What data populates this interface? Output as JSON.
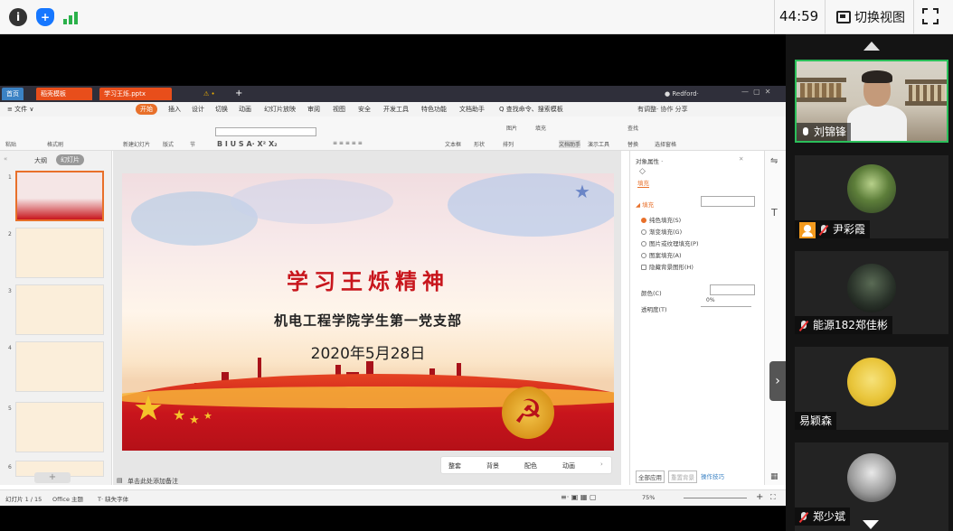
{
  "meeting": {
    "timer": "44:59",
    "switch_view_label": "切换视图"
  },
  "app": {
    "tabs": {
      "home": "首页",
      "template": "稻壳模板",
      "file": "学习王烁.pptx"
    },
    "user": "Redford·",
    "menu": [
      "≡ 文件 ∨",
      "开始",
      "插入",
      "设计",
      "切换",
      "动画",
      "幻灯片放映",
      "审阅",
      "视图",
      "安全",
      "开发工具",
      "特色功能",
      "文档助手",
      "Q 查找命令、搜索模板"
    ],
    "right_menu": "有调整·  协作  分享",
    "ribbon": {
      "paste": "粘贴",
      "format_painter": "格式刷",
      "new_slide": "新建幻灯片",
      "layout": "版式",
      "section": "节",
      "textbox": "文本框",
      "shape": "形状",
      "arrange": "排列",
      "image": "图片",
      "fill": "填充",
      "doc_assistant": "文档助手",
      "presentation_tools": "演示工具",
      "find": "查找",
      "replace": "替换",
      "select_pane": "选择窗格"
    },
    "outline_tabs": {
      "outline": "大纲",
      "slides": "幻灯片"
    },
    "thumbnails": [
      "1",
      "2",
      "3",
      "4",
      "5",
      "6"
    ],
    "slide": {
      "title": "学习王烁精神",
      "subtitle": "机电工程学院学生第一党支部",
      "date": "2020年5月28日"
    },
    "slide_toolbar": [
      "整套",
      "背景",
      "配色",
      "动画"
    ],
    "notes_placeholder": "单击此处添加备注",
    "property_panel": {
      "title": "对象属性 ·",
      "section": "填充",
      "fill_label": "◢ 填充",
      "options": [
        "纯色填充(S)",
        "渐变填充(G)",
        "图片或纹理填充(P)",
        "图案填充(A)",
        "隐藏背景图形(H)"
      ],
      "color_label": "颜色(C)",
      "transparency_label": "透明度(T)",
      "transparency_value": "0%",
      "apply_all": "全部应用",
      "reset_bg": "重置背景",
      "tips": "操作技巧"
    },
    "statusbar": {
      "slide_count": "幻灯片 1 / 15",
      "theme": "Office 主题",
      "font_missing": "缺失字体",
      "zoom": "75%"
    }
  },
  "participants": [
    {
      "name": "刘锦锋",
      "muted": false,
      "speaking": true,
      "host": false
    },
    {
      "name": "尹彩霞",
      "muted": true,
      "speaking": false,
      "host": true
    },
    {
      "name": "能源182郑佳彬",
      "muted": true,
      "speaking": false,
      "host": false
    },
    {
      "name": "易颖森",
      "muted": false,
      "speaking": false,
      "host": false
    },
    {
      "name": "郑少斌",
      "muted": true,
      "speaking": false,
      "host": false
    }
  ],
  "colors": {
    "accent": "#e8702a",
    "speaking_border": "#2bbf5a",
    "slide_red": "#c8161d"
  }
}
